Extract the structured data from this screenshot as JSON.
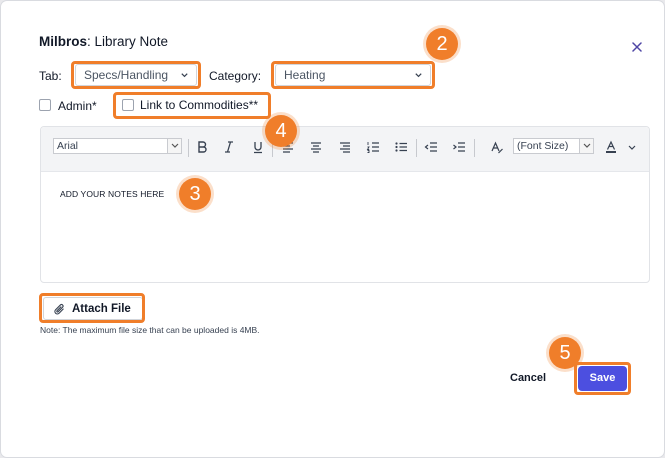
{
  "dialog": {
    "title_bold": "Milbros",
    "title_rest": ": Library Note",
    "close_icon": "close-icon"
  },
  "form": {
    "tab_label": "Tab:",
    "tab_value": "Specs/Handling",
    "category_label": "Category:",
    "category_value": "Heating",
    "admin_label": "Admin*",
    "link_label": "Link to Commodities**"
  },
  "editor": {
    "font_family": "Arial",
    "font_size": "(Font Size)",
    "tools": [
      "bold-icon",
      "italic-icon",
      "underline-icon",
      "align-left-icon",
      "align-center-icon",
      "align-right-icon",
      "ordered-list-icon",
      "unordered-list-icon",
      "outdent-icon",
      "indent-icon",
      "clear-format-icon",
      "font-color-icon"
    ],
    "content": "ADD YOUR NOTES HERE"
  },
  "attach": {
    "label": "Attach File",
    "icon": "paperclip-icon",
    "note": "Note: The maximum file size that can be uploaded is 4MB."
  },
  "footer": {
    "cancel_label": "Cancel",
    "save_label": "Save"
  },
  "callouts": [
    "2",
    "4",
    "3",
    "5"
  ],
  "colors": {
    "highlight": "#f07e2a",
    "primary": "#4c4fe0",
    "close_icon": "#4f46a5"
  }
}
